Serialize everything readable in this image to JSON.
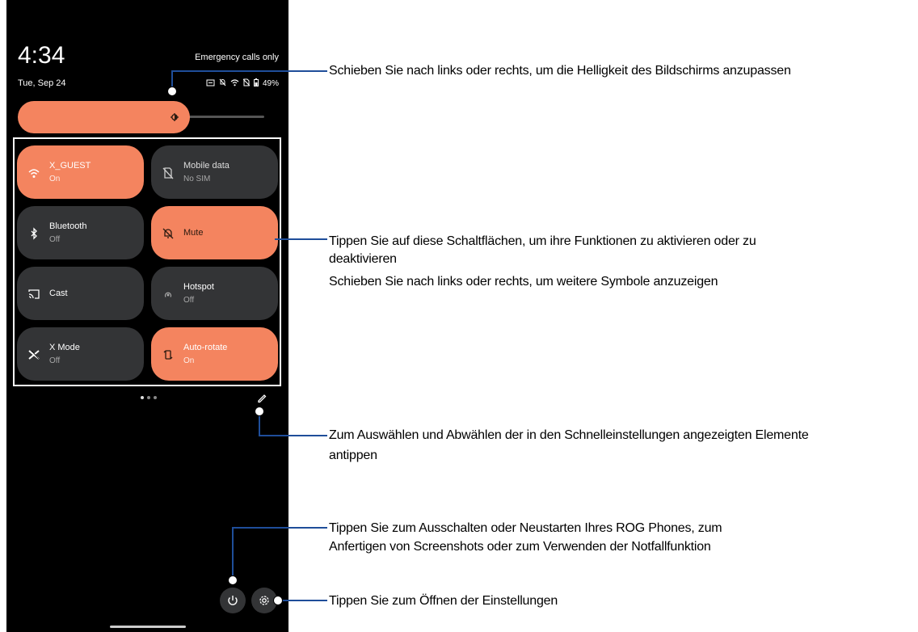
{
  "status_bar": {
    "time": "4:34",
    "date": "Tue, Sep 24",
    "emergency": "Emergency calls only",
    "battery": "49%"
  },
  "tiles": [
    {
      "label": "X_GUEST",
      "sub": "On",
      "state": "on",
      "icon": "wifi-icon"
    },
    {
      "label": "Mobile data",
      "sub": "No SIM",
      "state": "off",
      "icon": "no-sim-icon"
    },
    {
      "label": "Bluetooth",
      "sub": "Off",
      "state": "off",
      "icon": "bluetooth-icon"
    },
    {
      "label": "Mute",
      "sub": "",
      "state": "on",
      "icon": "mute-bell-icon"
    },
    {
      "label": "Cast",
      "sub": "",
      "state": "off",
      "icon": "cast-icon"
    },
    {
      "label": "Hotspot",
      "sub": "Off",
      "state": "off",
      "icon": "hotspot-icon"
    },
    {
      "label": "X Mode",
      "sub": "Off",
      "state": "off",
      "icon": "x-mode-icon"
    },
    {
      "label": "Auto-rotate",
      "sub": "On",
      "state": "on",
      "icon": "auto-rotate-icon"
    }
  ],
  "brightness": {
    "level": 0.68
  },
  "colors": {
    "accent": "#F4845F",
    "tile_off": "#333436",
    "callout_line": "#1F4E9A"
  },
  "annotations": {
    "brightness": "Schieben Sie nach links oder rechts, um die Helligkeit des Bildschirms anzupassen",
    "tiles_line1": "Tippen Sie auf diese Schaltflächen, um ihre Funktionen zu aktivieren oder zu",
    "tiles_line2": "deaktivieren",
    "tiles_line3": "Schieben Sie nach links oder rechts, um weitere Symbole anzuzeigen",
    "edit_line1": "Zum Auswählen und Abwählen der in den Schnelleinstellungen angezeigten Elemente",
    "edit_line2": "antippen",
    "power_line1": "Tippen Sie zum Ausschalten oder Neustarten Ihres ROG Phones, zum",
    "power_line2": "Anfertigen von Screenshots oder zum Verwenden der Notfallfunktion",
    "settings": "Tippen Sie zum Öffnen der Einstellungen"
  }
}
